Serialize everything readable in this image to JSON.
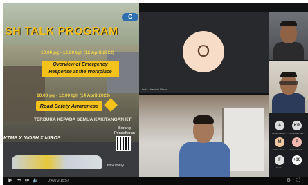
{
  "slide": {
    "title": "SH TALK PROGRAM",
    "logo": "C",
    "session1": {
      "time": "10.00 pg - 12.00 tgh (12 April 2023)",
      "topic_line1": "Overview of Emergency",
      "topic_line2": "Response at the Workplace"
    },
    "session2": {
      "time": "10.00 pg - 12.00 tgh (14 April 2023)",
      "topic": "Road Safety Awareness"
    },
    "note": "TERBUKA KEPADA SEMUA KAKITANGAN KT",
    "orgs": "KTMB X NIOSH X MIROS",
    "form_label_line1": "Borang",
    "form_label_line2": "Pendaftaran",
    "url": "https://bit.ly/..."
  },
  "participants": {
    "main_avatar_initial": "O",
    "main_tile_name": "ieola · Yasmin Ulhas",
    "grid": [
      {
        "initial": "A",
        "color": "#dcdcdc",
        "label": "Aliyah Nasrun..."
      },
      {
        "initial": "KR",
        "color": "#dcdcdc",
        "label": "Kamarudin Rad..."
      },
      {
        "initial": "M",
        "color": "#f1c8a0",
        "label": "Mahmud Saa..."
      },
      {
        "initial": "R",
        "color": "#f3b9b0",
        "label": "Rahim Ramli..."
      },
      {
        "initial": "F",
        "color": "#e2e2e2",
        "label": "Fauzi..."
      },
      {
        "initial": "+10",
        "color": "#ffffff",
        "label": ""
      }
    ]
  },
  "playback": {
    "time": "0:49 / 2:15:57",
    "progress": 0.006
  },
  "controls": {
    "icons": [
      "play-icon",
      "skip-back-icon",
      "skip-forward-icon",
      "volume-icon"
    ]
  }
}
